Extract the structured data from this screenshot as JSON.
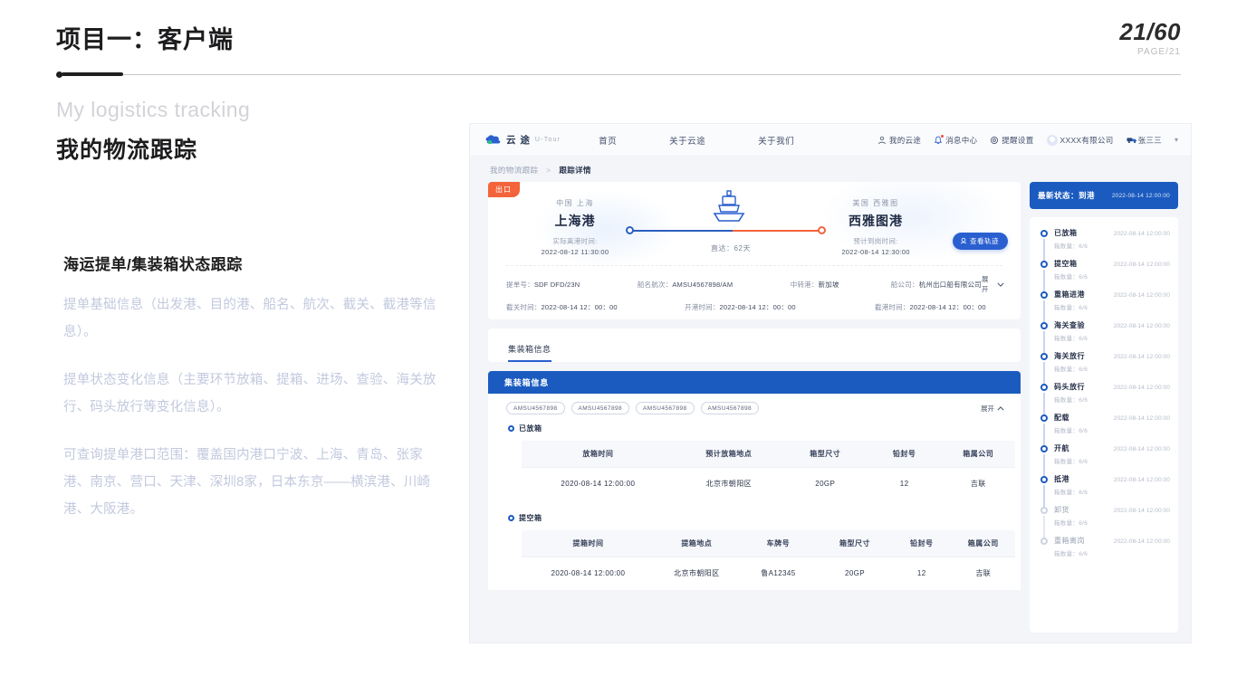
{
  "slide": {
    "title": "项目一：客户端",
    "page_big": "21/60",
    "page_small": "PAGE/21",
    "subtitle_en": "My logistics tracking",
    "subtitle_cn": "我的物流跟踪",
    "section_heading": "海运提单/集装箱状态跟踪",
    "paragraphs": [
      "提单基础信息（出发港、目的港、船名、航次、截关、截港等信息）。",
      "提单状态变化信息（主要环节放箱、提箱、进场、查验、海关放行、码头放行等变化信息）。",
      "可查询提单港口范围：覆盖国内港口宁波、上海、青岛、张家港、南京、营口、天津、深圳8家，日本东京——横滨港、川崎港、大阪港。"
    ]
  },
  "app": {
    "brand": {
      "cn": "云 途",
      "en": "U-Tour",
      "icon": "cloud-logo-icon"
    },
    "nav_links": [
      "首页",
      "关于云途",
      "关于我们"
    ],
    "nav_utils": [
      {
        "label": "我的云途",
        "icon": "user-icon",
        "badge": false
      },
      {
        "label": "消息中心",
        "icon": "bell-icon",
        "badge": true
      },
      {
        "label": "提醒设置",
        "icon": "gear-icon",
        "badge": false
      }
    ],
    "company": "XXXX有限公司",
    "user": "张三三",
    "caret": "▾",
    "breadcrumb": {
      "root": "我的物流跟踪",
      "sep": ">",
      "current": "跟踪详情"
    },
    "route": {
      "tag": "出口",
      "origin": {
        "country_city": "中国 上海",
        "port": "上海港",
        "time_label": "实际离港时间:",
        "time_value": "2022-08-12  11:30:00"
      },
      "destination": {
        "country_city": "美国 西雅图",
        "port": "西雅图港",
        "time_label": "预计到岗时间:",
        "time_value": "2022-08-14  12:30:00"
      },
      "transit": "直达：62天",
      "track_button": "查看轨迹",
      "track_button_icon": "location-icon"
    },
    "meta_row1": [
      {
        "k": "提单号：",
        "v": "SDF DFD/23N"
      },
      {
        "k": "船名航次：",
        "v": "AMSU4567898/AM"
      },
      {
        "k": "中转港：",
        "v": "新加坡"
      },
      {
        "k": "船公司：",
        "v": "杭州出口船有限公司"
      }
    ],
    "meta_row2": [
      {
        "k": "截关时间：",
        "v": "2022-08-14  12：00：00"
      },
      {
        "k": "开港时间：",
        "v": "2022-08-14  12：00：00"
      },
      {
        "k": "截港时间：",
        "v": "2022-08-14  12：00：00"
      }
    ],
    "expand_label": "展开",
    "expand_icon": "chevron-down-icon",
    "collapse_icon": "chevron-up-icon",
    "tab_label": "集装箱信息",
    "container_panel_title": "集装箱信息",
    "container_chips": [
      "AMSU4567898",
      "AMSU4567898",
      "AMSU4567898",
      "AMSU4567898"
    ],
    "chips_expand_label": "展开",
    "sections": [
      {
        "label": "已放箱",
        "columns": [
          "放箱时间",
          "预计放箱地点",
          "箱型尺寸",
          "铅封号",
          "箱属公司"
        ],
        "rows": [
          [
            "2020-08-14  12:00:00",
            "北京市朝阳区",
            "20GP",
            "12",
            "吉联"
          ]
        ]
      },
      {
        "label": "提空箱",
        "columns": [
          "提箱时间",
          "提箱地点",
          "车牌号",
          "箱型尺寸",
          "铅封号",
          "箱属公司"
        ],
        "rows": [
          [
            "2020-08-14  12:00:00",
            "北京市朝阳区",
            "鲁A12345",
            "20GP",
            "12",
            "吉联"
          ]
        ]
      }
    ],
    "status_bar": {
      "title": "最新状态：到港",
      "time": "2022-08-14 12:00:00"
    },
    "timeline": [
      {
        "name": "已放箱",
        "time": "2022-08-14 12:00:00",
        "sub": "箱数量：6/6",
        "done": true
      },
      {
        "name": "提空箱",
        "time": "2022-08-14 12:00:00",
        "sub": "箱数量：6/6",
        "done": true
      },
      {
        "name": "重箱进港",
        "time": "2022-08-14 12:00:00",
        "sub": "箱数量：6/6",
        "done": true
      },
      {
        "name": "海关查验",
        "time": "2022-08-14 12:00:00",
        "sub": "箱数量：6/6",
        "done": true
      },
      {
        "name": "海关放行",
        "time": "2022-08-14 12:00:00",
        "sub": "箱数量：6/6",
        "done": true
      },
      {
        "name": "码头放行",
        "time": "2022-08-14 12:00:00",
        "sub": "箱数量：6/6",
        "done": true
      },
      {
        "name": "配载",
        "time": "2022-08-14 12:00:00",
        "sub": "箱数量：6/6",
        "done": true
      },
      {
        "name": "开航",
        "time": "2022-08-14 12:00:00",
        "sub": "箱数量：6/6",
        "done": true
      },
      {
        "name": "抵港",
        "time": "2022-08-14 12:00:00",
        "sub": "箱数量：6/6",
        "done": true
      },
      {
        "name": "卸货",
        "time": "2022-08-14 12:00:00",
        "sub": "箱数量：6/6",
        "done": false
      },
      {
        "name": "重箱离岗",
        "time": "2022-08-14 12:00:00",
        "sub": "箱数量：6/6",
        "done": false
      }
    ]
  },
  "colors": {
    "brand_blue": "#1b5bbf",
    "accent_orange": "#f4643c",
    "muted_text": "#c2c9de"
  }
}
